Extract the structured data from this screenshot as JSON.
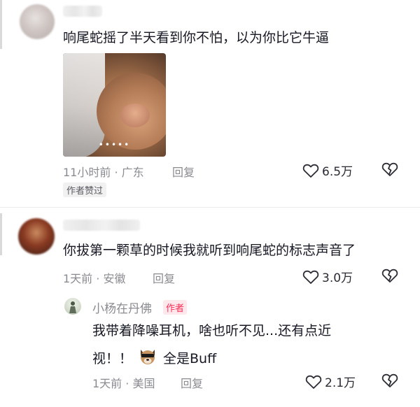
{
  "comments": [
    {
      "text": "响尾蛇摇了半天看到你不怕，以为你比它牛逼",
      "image": {
        "indicator": "•••••"
      },
      "meta": "11小时前 · 广东",
      "reply_label": "回复",
      "likes": "6.5万",
      "author_liked": "作者赞过"
    },
    {
      "text": "你拔第一颗草的时候我就听到响尾蛇的标志声音了",
      "meta": "1天前 · 安徽",
      "reply_label": "回复",
      "likes": "3.0万",
      "reply": {
        "username": "小杨在丹佛",
        "author_tag": "作者",
        "text_line1": "我带着降噪耳机，啥也听不见...还有点近",
        "text_line2_a": "视！！",
        "text_line2_b": "全是Buff",
        "meta": "1天前 · 美国",
        "reply_label": "回复",
        "likes": "2.1万"
      }
    }
  ],
  "colors": {
    "text": "#161823",
    "meta": "#8a8b91",
    "author_tag": "#fe2c55"
  },
  "icons": [
    "heart-outline-icon",
    "broken-heart-icon",
    "dog-emoji-icon"
  ]
}
